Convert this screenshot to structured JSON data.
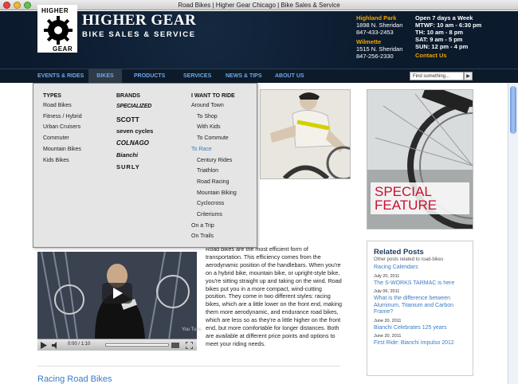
{
  "window": {
    "title": "Road Bikes | Higher Gear Chicago | Bike Sales & Service"
  },
  "logo": {
    "top": "HIGHER",
    "bottom": "GEAR"
  },
  "brand": {
    "name": "HIGHER GEAR",
    "tagline": "BIKE SALES & SERVICE"
  },
  "locations": [
    {
      "name": "Highland Park",
      "address": "1898 N. Sheridan",
      "phone": "847-433-2453"
    },
    {
      "name": "Wilmette",
      "address": "1515 N. Sheridan",
      "phone": "847-256-2330"
    }
  ],
  "hours": {
    "heading": "Open 7 days a Week",
    "lines": [
      "MTWF: 10 am - 6:30 pm",
      "TH: 10 am - 8 pm",
      "SAT: 9 am - 5 pm",
      "SUN: 12 pm - 4 pm"
    ],
    "contact": "Contact Us"
  },
  "nav": {
    "items": [
      "EVENTS & RIDES",
      "BIKES",
      "PRODUCTS",
      "SERVICES",
      "NEWS & TIPS",
      "ABOUT US"
    ],
    "search_placeholder": "Find something...",
    "search_button": "▶"
  },
  "dropdown": {
    "types": {
      "heading": "TYPES",
      "items": [
        "Road Bikes",
        "Fitness / Hybrid",
        "Urban Cruisers",
        "Commuter",
        "Mountain Bikes",
        "Kids Bikes"
      ]
    },
    "brands": {
      "heading": "BRANDS",
      "items": [
        "SPECIALIZED",
        "SCOTT",
        "seven cycles",
        "COLNAGO",
        "Bianchi",
        "SURLY"
      ]
    },
    "ride": {
      "heading": "I WANT TO RIDE",
      "items": [
        {
          "label": "Around Town",
          "level": 0
        },
        {
          "label": "To Shop",
          "level": 1
        },
        {
          "label": "With Kids",
          "level": 1
        },
        {
          "label": "To Commute",
          "level": 1
        },
        {
          "label": "To Race",
          "level": 0,
          "active": true
        },
        {
          "label": "Century Rides",
          "level": 1
        },
        {
          "label": "Triathlon",
          "level": 1
        },
        {
          "label": "Road Racing",
          "level": 1
        },
        {
          "label": "Mountain Biking",
          "level": 1
        },
        {
          "label": "Cyclocross",
          "level": 1
        },
        {
          "label": "Criteriums",
          "level": 1
        },
        {
          "label": "On a Trip",
          "level": 0
        },
        {
          "label": "On Trails",
          "level": 0
        }
      ]
    }
  },
  "feature": {
    "line1": "SPECIAL",
    "line2": "FEATURE"
  },
  "related": {
    "title": "Related Posts",
    "subtitle": "Other posts related to road-bikes",
    "posts": [
      {
        "title": "Racing Calendars",
        "date": "July 20, 2011"
      },
      {
        "title": "The S-WORKS TARMAC is here",
        "date": "July 06, 2011"
      },
      {
        "title": "What is the difference between Aluminum, Titanium and Carbon Frame?",
        "date": "June 20, 2011"
      },
      {
        "title": "Bianchi Celebrates 125 years",
        "date": "June 20, 2011"
      },
      {
        "title": "First Ride: Bianchi Impulso 2012",
        "date": "June 20, 2011"
      }
    ]
  },
  "video": {
    "time": "0:00 / 1:10",
    "badge": "You Tube"
  },
  "article": {
    "text": "Road bikes are the most efficient form of transportation. This efficiency comes from the aerodynamic position of the handlebars. When you're on a hybrid bike, mountain bike, or upright-style bike, you're sitting straight up and taking on the wind. Road bikes put you in a more compact, wind-cutting position. They come in two different styles: racing bikes, which are a little lower on the front end, making them more aerodynamic, and endurance road bikes, which are less so as they're a little higher on the front end, but more comfortable for longer distances. Both are available at different price points and options to meet your riding needs.",
    "section_title": "Racing Road Bikes"
  }
}
